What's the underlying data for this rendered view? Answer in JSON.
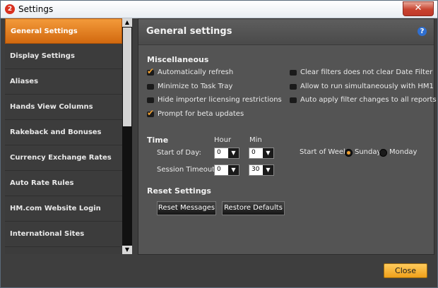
{
  "window": {
    "title": "Settings",
    "app_icon": "2"
  },
  "sidebar": {
    "items": [
      {
        "label": "General Settings",
        "active": true
      },
      {
        "label": "Display Settings"
      },
      {
        "label": "Aliases"
      },
      {
        "label": "Hands View Columns"
      },
      {
        "label": "Rakeback and Bonuses"
      },
      {
        "label": "Currency Exchange Rates"
      },
      {
        "label": "Auto Rate Rules"
      },
      {
        "label": "HM.com Website Login"
      },
      {
        "label": "International Sites"
      }
    ]
  },
  "panel": {
    "title": "General settings",
    "help": "?",
    "misc": {
      "heading": "Miscellaneous",
      "left": [
        {
          "label": "Automatically refresh",
          "checked": true
        },
        {
          "label": "Minimize to Task Tray",
          "checked": false
        },
        {
          "label": "Hide importer licensing restrictions",
          "checked": false
        },
        {
          "label": "Prompt for beta updates",
          "checked": true
        }
      ],
      "right": [
        {
          "label": "Clear filters does not clear Date Filter",
          "checked": false
        },
        {
          "label": "Allow to run simultaneously with HM1",
          "checked": false
        },
        {
          "label": "Auto apply filter changes to all reports",
          "checked": false
        }
      ]
    },
    "time": {
      "heading": "Time",
      "hour_label": "Hour",
      "min_label": "Min",
      "start_of_day_label": "Start of Day:",
      "start_of_day_hour": "0",
      "start_of_day_min": "0",
      "session_timeout_label": "Session Timeout:",
      "session_timeout_hour": "0",
      "session_timeout_min": "30",
      "start_of_week_label": "Start of Week:",
      "week_options": [
        "Sunday",
        "Monday"
      ],
      "week_selected": "Sunday"
    },
    "reset": {
      "heading": "Reset Settings",
      "reset_messages": "Reset Messages",
      "restore_defaults": "Restore Defaults"
    }
  },
  "footer": {
    "close_label": "Close"
  }
}
